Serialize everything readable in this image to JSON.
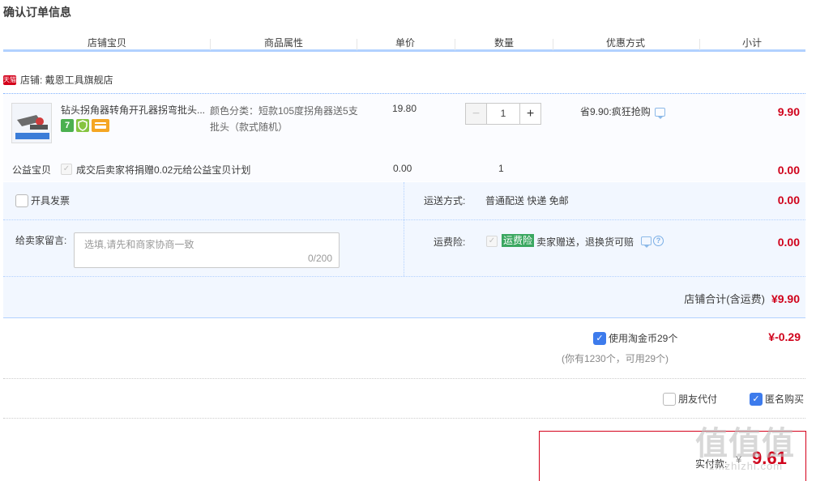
{
  "page": {
    "title": "确认订单信息"
  },
  "table_header": [
    "店铺宝贝",
    "商品属性",
    "单价",
    "数量",
    "优惠方式",
    "小计"
  ],
  "shop": {
    "badge": "天猫",
    "label": "店铺: 戴恩工具旗舰店"
  },
  "item": {
    "title": "钻头拐角器转角开孔器拐弯批头...",
    "badges": [
      "7",
      "盾",
      "卡"
    ],
    "attr": "颜色分类：短款105度拐角器送5支批头（款式随机）",
    "price": "19.80",
    "qty": "1",
    "qty_minus": "−",
    "qty_plus": "+",
    "promo": "省9.90:疯狂抢购",
    "subtotal": "9.90"
  },
  "charity": {
    "label": "公益宝贝",
    "text": "成交后卖家将捐赠0.02元给公益宝贝计划",
    "price": "0.00",
    "qty": "1",
    "subtotal": "0.00"
  },
  "invoice": {
    "label": "开具发票"
  },
  "shipping": {
    "label": "运送方式:",
    "value": "普通配送 快递 免邮",
    "subtotal": "0.00"
  },
  "message": {
    "label": "给卖家留言:",
    "placeholder": "选填,请先和商家协商一致",
    "count": "0/200"
  },
  "insurance": {
    "label": "运费险:",
    "tag": "运费险",
    "text": "卖家赠送，退换货可赔",
    "subtotal": "0.00"
  },
  "shop_total": {
    "label": "店铺合计(含运费)",
    "value": "¥9.90"
  },
  "coins": {
    "label": "使用淘金币29个",
    "value": "¥-0.29",
    "note": "(你有1230个，可用29个)",
    "checked": true
  },
  "options": {
    "friend_pay": "朋友代付",
    "anonymous": "匿名购买"
  },
  "payment": {
    "label": "实付款:",
    "currency": "¥",
    "value": "9.61"
  },
  "watermark": {
    "main": "值值值",
    "sub": "zhizhizhi.com"
  }
}
